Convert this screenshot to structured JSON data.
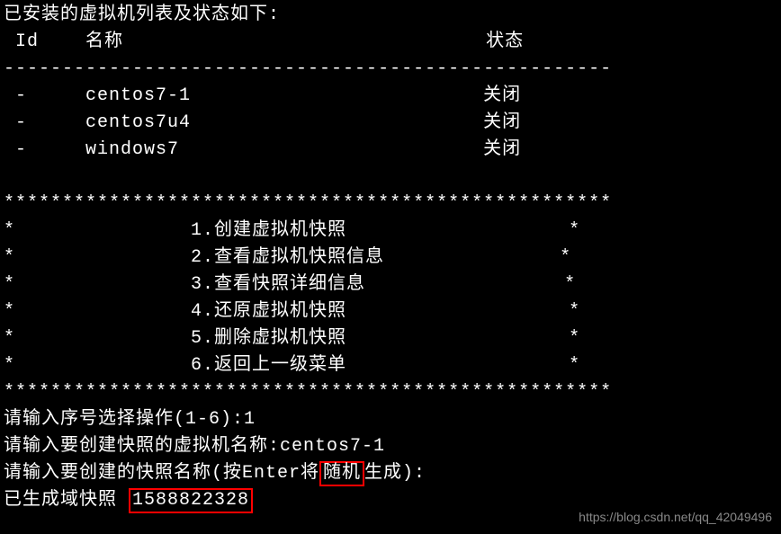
{
  "title": "已安装的虚拟机列表及状态如下:",
  "header": {
    "id": " Id",
    "name": "名称",
    "state": "状态"
  },
  "dashes": "----------------------------------------------------",
  "vms": [
    {
      "id": " -",
      "name": "centos7-1",
      "state": "关闭"
    },
    {
      "id": " -",
      "name": "centos7u4",
      "state": "关闭"
    },
    {
      "id": " -",
      "name": "windows7",
      "state": "关闭"
    }
  ],
  "stars": "****************************************************",
  "menu": [
    {
      "num": "1",
      "label": "创建虚拟机快照"
    },
    {
      "num": "2",
      "label": "查看虚拟机快照信息"
    },
    {
      "num": "3",
      "label": "查看快照详细信息"
    },
    {
      "num": "4",
      "label": "还原虚拟机快照"
    },
    {
      "num": "5",
      "label": "删除虚拟机快照"
    },
    {
      "num": "6",
      "label": "返回上一级菜单"
    }
  ],
  "prompts": {
    "select": "请输入序号选择操作(1-6):",
    "select_value": "1",
    "vm_name_prompt": "请输入要创建快照的虚拟机名称:",
    "vm_name_value": "centos7-1",
    "snap_prompt_pre": "请输入要创建的快照名称(按Enter将",
    "snap_prompt_hl": "随机",
    "snap_prompt_post": "生成):",
    "result_pre": "已生成域快照 ",
    "result_hl": "1588822328"
  },
  "watermark": "https://blog.csdn.net/qq_42049496"
}
